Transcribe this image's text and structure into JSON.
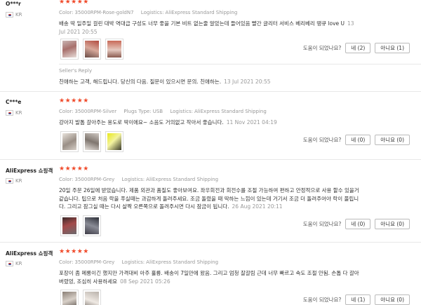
{
  "helpful_label": "도움이 되었나요?",
  "reviews": [
    {
      "author": "O***r",
      "country": "KR",
      "stars": "★★★★★",
      "color_k": "Color:",
      "color_v": "35000RPM-Rose-goldN7",
      "log_k": "Logistics:",
      "log_v": "AliExpress Standard Shipping",
      "text": "배송 딱 일주일 걸린 대박 역대급 구성도 너무 좋을 기본 비트 없는줄 알았는데 들어있음 빨간 글리터 서비스 베리베리 땡큐 love U",
      "date": "13 Jul 2021 20:55",
      "yes": "네 (2)",
      "no": "아니요 (1)",
      "reply_header": "Seller's Reply",
      "reply_text": "친애하는 고객, 해드립니다. 당신의 다음. 질문이 있으시면 문의. 친애하는.",
      "reply_date": "13 Jul 2021 20:55"
    },
    {
      "author": "C***e",
      "country": "KR",
      "stars": "★★★★★",
      "color_k": "Color:",
      "color_v": "35000RPM-Silver",
      "plugs_k": "Plugs Type:",
      "plugs_v": "USB",
      "log_k": "Logistics:",
      "log_v": "AliExpress Standard Shipping",
      "text": "강아지 발톱 갈아주는 용도로 딱이에요~ 소음도 거의없고 작아서 좋습니다.",
      "date": "11 Nov 2021 04:19",
      "yes": "네 (0)",
      "no": "아니요 (0)"
    },
    {
      "author": "AliExpress 쇼핑객",
      "country": "KR",
      "stars": "★★★★★",
      "color_k": "Color:",
      "color_v": "35000RPM-Grey",
      "log_k": "Logistics:",
      "log_v": "AliExpress Standard Shipping",
      "text": "20일 주문 26일에 받았습니다. 제품 외관과 품질도 좋아보여요. 좌우회전과 회전수를 조절 가능하여 편하고 안정적으로 사용 할수 있을거 같습니다. 팁으로 처음 락을 푸실때는 과감하게 돌려주세요. 조금 돌렸을 때 딱하는 느낌이 있는데 거기서 조금 더 돌려주어야 락이 풀립니다. 그리고 잠그실 때는 다시 살짝 오른쪽으로 돌려주시면 다시 잠금이 됩니다.",
      "date": "26 Aug 2021 20:11",
      "yes": "네 (0)",
      "no": "아니요 (0)"
    },
    {
      "author": "AliExpress 쇼핑객",
      "country": "KR",
      "stars": "★★★★★",
      "color_k": "Color:",
      "color_v": "35000RPM-Grey",
      "log_k": "Logistics:",
      "log_v": "AliExpress Standard Shipping",
      "text": "포장이 좀 메롱이긴 했지만 가격대비 아주 훌륭. 배송이 7일만에 왔음. 그리고 엄청 잘갈림 근데 너무 빠르고 속도 조절 안됨. 손톱 다 갈아버렸엉, 조심히 사용하세요",
      "date": "08 Sep 2021 05:26",
      "yes": "네 (1)",
      "no": "아니요 (0)"
    }
  ]
}
